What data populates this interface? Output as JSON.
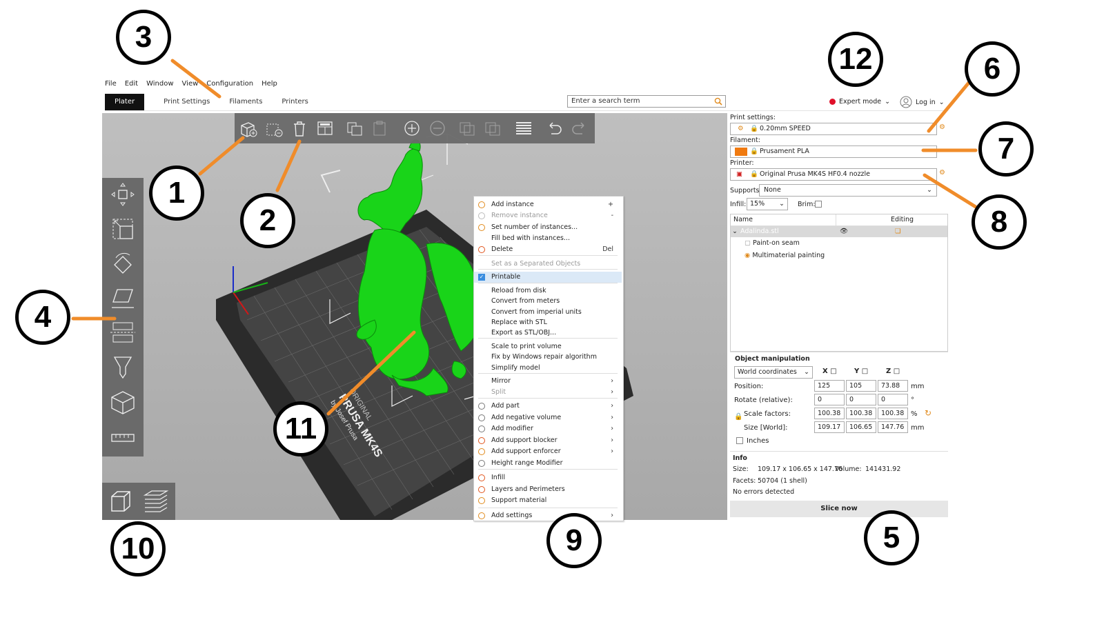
{
  "menu": [
    "File",
    "Edit",
    "Window",
    "View",
    "Configuration",
    "Help"
  ],
  "tabs": [
    "Plater",
    "Print Settings",
    "Filaments",
    "Printers"
  ],
  "search": {
    "placeholder": "Enter a search term"
  },
  "header": {
    "mode": "Expert mode",
    "login": "Log in"
  },
  "context_menu": {
    "items": [
      {
        "label": "Add instance",
        "shortcut": "+",
        "icon": "add-instance-icon"
      },
      {
        "label": "Remove instance",
        "shortcut": "-",
        "disabled": true,
        "icon": "remove-instance-icon"
      },
      {
        "label": "Set number of instances...",
        "icon": "instances-icon"
      },
      {
        "label": "Fill bed with instances..."
      },
      {
        "label": "Delete",
        "shortcut": "Del",
        "icon": "delete-icon"
      },
      {
        "label": "Set as a Separated Objects",
        "disabled": true
      },
      {
        "label": "Printable",
        "checked": true
      },
      {
        "label": "Reload from disk"
      },
      {
        "label": "Convert from meters"
      },
      {
        "label": "Convert from imperial units"
      },
      {
        "label": "Replace with STL"
      },
      {
        "label": "Export as STL/OBJ..."
      },
      {
        "label": "Scale to print volume"
      },
      {
        "label": "Fix by Windows repair algorithm"
      },
      {
        "label": "Simplify model"
      },
      {
        "label": "Mirror",
        "submenu": true
      },
      {
        "label": "Split",
        "submenu": true,
        "disabled": true
      },
      {
        "label": "Add part",
        "submenu": true,
        "icon": "add-part-icon"
      },
      {
        "label": "Add negative volume",
        "submenu": true,
        "icon": "negative-volume-icon"
      },
      {
        "label": "Add modifier",
        "submenu": true,
        "icon": "modifier-icon"
      },
      {
        "label": "Add support blocker",
        "submenu": true,
        "icon": "support-blocker-icon"
      },
      {
        "label": "Add support enforcer",
        "submenu": true,
        "icon": "support-enforcer-icon"
      },
      {
        "label": "Height range Modifier",
        "icon": "height-range-icon"
      },
      {
        "label": "Infill",
        "icon": "infill-icon"
      },
      {
        "label": "Layers and Perimeters",
        "icon": "layers-icon"
      },
      {
        "label": "Support material",
        "icon": "support-icon"
      },
      {
        "label": "Add settings",
        "submenu": true,
        "icon": "settings-icon"
      }
    ]
  },
  "right_panel": {
    "print_settings_label": "Print settings:",
    "print_settings_value": "0.20mm SPEED",
    "filament_label": "Filament:",
    "filament_value": "Prusament PLA",
    "filament_color": "#f07a10",
    "printer_label": "Printer:",
    "printer_value": "Original Prusa MK4S HF0.4 nozzle",
    "supports_label": "Supports:",
    "supports_value": "None",
    "infill_label": "Infill:",
    "infill_value": "15%",
    "brim_label": "Brim:",
    "list_header_name": "Name",
    "list_header_editing": "Editing",
    "object_name": "Adalinda.stl",
    "sub_items": [
      "Paint-on seam",
      "Multimaterial painting"
    ]
  },
  "manipulation": {
    "title": "Object manipulation",
    "coords": "World coordinates",
    "axes": [
      "X",
      "Y",
      "Z"
    ],
    "position_label": "Position:",
    "position": [
      "125",
      "105",
      "73.88"
    ],
    "position_unit": "mm",
    "rotate_label": "Rotate (relative):",
    "rotate": [
      "0",
      "0",
      "0"
    ],
    "rotate_unit": "°",
    "scale_label": "Scale factors:",
    "scale": [
      "100.38",
      "100.38",
      "100.38"
    ],
    "scale_unit": "%",
    "size_label": "Size [World]:",
    "size": [
      "109.17",
      "106.65",
      "147.76"
    ],
    "size_unit": "mm",
    "inches_label": "Inches"
  },
  "info": {
    "title": "Info",
    "size_label": "Size:",
    "size_value": "109.17 x 106.65 x 147.76",
    "volume_label": "Volume:",
    "volume_value": "141431.92",
    "facets_label": "Facets:",
    "facets_value": "50704 (1 shell)",
    "errors": "No errors detected"
  },
  "slice_button": "Slice now",
  "bed_text": {
    "line1": "ORIGINAL",
    "line2": "PRUSA MK4S",
    "line3": "by Josef Prusa"
  },
  "callouts": [
    "1",
    "2",
    "3",
    "4",
    "5",
    "6",
    "7",
    "8",
    "9",
    "10",
    "11",
    "12"
  ],
  "colors": {
    "accent": "#f08c2a",
    "model": "#19d419",
    "record": "#e0102a",
    "toolbar": "#6a6a6a"
  }
}
